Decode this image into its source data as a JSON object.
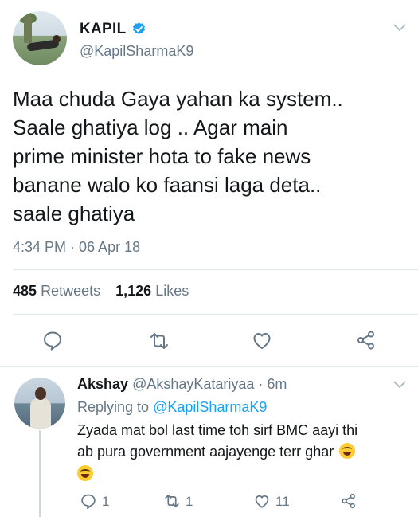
{
  "tweet": {
    "display_name": "KAPIL",
    "handle": "@KapilSharmaK9",
    "text_lines": [
      "Maa chuda Gaya yahan ka system..",
      "Saale ghatiya log .. Agar main",
      "prime minister hota to fake news",
      "banane walo ko faansi laga deta..",
      "saale ghatiya"
    ],
    "timestamp": "4:34 PM · 06 Apr 18",
    "retweets_count": "485",
    "retweets_label": "Retweets",
    "likes_count": "1,126",
    "likes_label": "Likes"
  },
  "reply": {
    "display_name": "Akshay",
    "handle": "@AkshayKatariyaa",
    "time": "· 6m",
    "replying_prefix": "Replying to",
    "replying_to": "@KapilSharmaK9",
    "text_line1": "Zyada mat bol last time toh sirf BMC aayi thi",
    "text_line2": "ab pura government aajayenge terr ghar",
    "reply_count": "1",
    "retweet_count": "1",
    "like_count": "11"
  },
  "icons": {
    "verified": "verified-badge-icon",
    "chevron": "chevron-down-icon",
    "reply": "reply-icon",
    "retweet": "retweet-icon",
    "like": "heart-icon",
    "share": "share-icon",
    "emoji": "rolling-laughing-emoji"
  },
  "colors": {
    "accent": "#1da1f2",
    "secondary_text": "#657786",
    "primary_text": "#14171a",
    "divider": "#e1e8ed"
  }
}
